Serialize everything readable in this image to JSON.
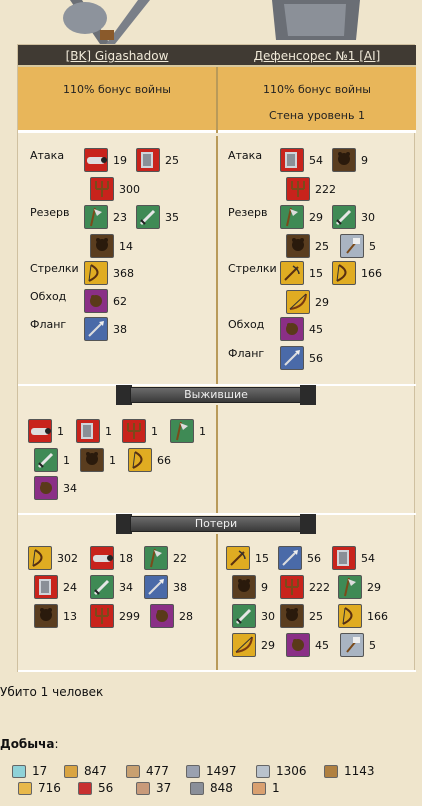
{
  "left_player": {
    "name": "[BK] Gigashadow",
    "bonus": "110% бонус войны"
  },
  "right_player": {
    "name": "Дефенсорес №1 [AI]",
    "bonus": "110% бонус войны",
    "wall": "Стена уровень 1"
  },
  "labels": {
    "attack": "Атака",
    "reserve": "Резерв",
    "archers": "Стрелки",
    "flank_around": "Обход",
    "flank": "Фланг"
  },
  "left_units": {
    "attack": [
      {
        "icon": "cannon-icon",
        "count": "19"
      },
      {
        "icon": "ram-icon",
        "count": "25"
      },
      {
        "icon": "trident-icon",
        "count": "300"
      }
    ],
    "reserve": [
      {
        "icon": "halberd-icon",
        "count": "23"
      },
      {
        "icon": "sword-icon",
        "count": "35"
      },
      {
        "icon": "bear-icon",
        "count": "14"
      }
    ],
    "archers": [
      {
        "icon": "bow-icon",
        "count": "368"
      }
    ],
    "flank_around": [
      {
        "icon": "bear-purple-icon",
        "count": "62"
      }
    ],
    "flank": [
      {
        "icon": "spear-icon",
        "count": "38"
      }
    ]
  },
  "right_units": {
    "attack": [
      {
        "icon": "ram-icon",
        "count": "54"
      },
      {
        "icon": "bear-icon",
        "count": "9"
      },
      {
        "icon": "trident-icon",
        "count": "222"
      }
    ],
    "reserve": [
      {
        "icon": "halberd-icon",
        "count": "29"
      },
      {
        "icon": "sword-icon",
        "count": "30"
      },
      {
        "icon": "bear-icon",
        "count": "25"
      },
      {
        "icon": "hammer-icon",
        "count": "5"
      }
    ],
    "archers": [
      {
        "icon": "crossbow-icon",
        "count": "15"
      },
      {
        "icon": "bow-icon",
        "count": "166"
      },
      {
        "icon": "longbow-icon",
        "count": "29"
      }
    ],
    "flank_around": [
      {
        "icon": "bear-purple-icon",
        "count": "45"
      }
    ],
    "flank": [
      {
        "icon": "spear-icon",
        "count": "56"
      }
    ]
  },
  "survivors": {
    "title": "Выжившие",
    "left": [
      {
        "icon": "cannon-icon",
        "count": "1"
      },
      {
        "icon": "ram-icon",
        "count": "1"
      },
      {
        "icon": "trident-icon",
        "count": "1"
      },
      {
        "icon": "halberd-icon",
        "count": "1"
      },
      {
        "icon": "sword-icon",
        "count": "1"
      },
      {
        "icon": "bear-icon",
        "count": "1"
      },
      {
        "icon": "bow-icon",
        "count": "66"
      },
      {
        "icon": "bear-purple-icon",
        "count": "34"
      }
    ]
  },
  "losses": {
    "title": "Потери",
    "left": [
      {
        "icon": "bow-icon",
        "count": "302"
      },
      {
        "icon": "cannon-icon",
        "count": "18"
      },
      {
        "icon": "halberd-icon",
        "count": "22"
      },
      {
        "icon": "ram-icon",
        "count": "24"
      },
      {
        "icon": "sword-icon",
        "count": "34"
      },
      {
        "icon": "spear-icon",
        "count": "38"
      },
      {
        "icon": "bear-icon",
        "count": "13"
      },
      {
        "icon": "trident-icon",
        "count": "299"
      },
      {
        "icon": "bear-purple-icon",
        "count": "28"
      }
    ],
    "right": [
      {
        "icon": "crossbow-icon",
        "count": "15"
      },
      {
        "icon": "spear-icon",
        "count": "56"
      },
      {
        "icon": "ram-icon",
        "count": "54"
      },
      {
        "icon": "bear-icon",
        "count": "9"
      },
      {
        "icon": "trident-icon",
        "count": "222"
      },
      {
        "icon": "halberd-icon",
        "count": "29"
      },
      {
        "icon": "sword-icon",
        "count": "30"
      },
      {
        "icon": "bear-icon",
        "count": "25"
      },
      {
        "icon": "bow-icon",
        "count": "166"
      },
      {
        "icon": "longbow-icon",
        "count": "29"
      },
      {
        "icon": "bear-purple-icon",
        "count": "45"
      },
      {
        "icon": "hammer-icon",
        "count": "5"
      }
    ]
  },
  "killed_text": "Убито 1 человек",
  "loot": {
    "title": "Добыча",
    "title_suffix": ":",
    "items": [
      {
        "icon": "potion-icon",
        "value": "17"
      },
      {
        "icon": "scroll-icon",
        "value": "847"
      },
      {
        "icon": "bread-icon",
        "value": "477"
      },
      {
        "icon": "ingot-icon",
        "value": "1497"
      },
      {
        "icon": "ore-icon",
        "value": "1306"
      },
      {
        "icon": "quill-icon",
        "value": "1143"
      },
      {
        "icon": "gold-icon",
        "value": "716"
      },
      {
        "icon": "apple-icon",
        "value": "56"
      },
      {
        "icon": "feather-icon",
        "value": "37"
      },
      {
        "icon": "tool-icon",
        "value": "848"
      },
      {
        "icon": "candle-icon",
        "value": "1"
      }
    ]
  },
  "colors": {
    "header_bg": "#403a33",
    "bonus_bg": "#e8b65a",
    "report_bg": "#f2e9d3",
    "red_unit": "#c8231c",
    "green_unit": "#3f8a55",
    "yellow_unit": "#e0ac22",
    "brown_unit": "#5a3d1f",
    "purple_unit": "#8a2f86",
    "blue_unit": "#4a6aa8",
    "gray_unit": "#a9b4c2"
  }
}
